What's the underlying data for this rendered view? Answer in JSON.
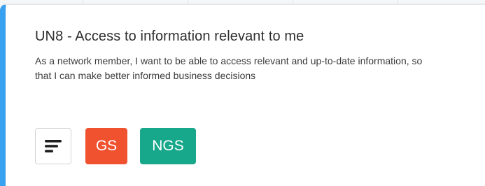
{
  "story": {
    "title": "UN8 - Access to information relevant to me",
    "description": "As a network member, I want to be able to access relevant and up-to-date information, so that I can make better informed business decisions"
  },
  "actions": {
    "menu_icon": "text-align-left-icon",
    "tags": [
      {
        "label": "GS",
        "color": "#f0512f"
      },
      {
        "label": "NGS",
        "color": "#17a78a"
      }
    ]
  },
  "colors": {
    "card_accent": "#3aa0f0"
  }
}
